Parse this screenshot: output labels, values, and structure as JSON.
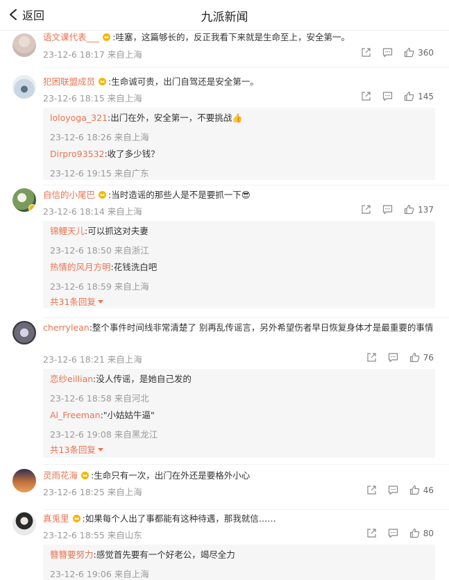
{
  "header": {
    "back_label": "返回",
    "title": "九派新闻"
  },
  "comments": [
    {
      "user": "语文课代表___",
      "text": ":哇塞，这篇够长的，反正我看下来就是生命至上，安全第一。",
      "time": "23-12-6 18:17 来自上海",
      "likes": "360",
      "more_replies": "",
      "replies": []
    },
    {
      "user": "犯困联盟成员",
      "text": ":生命诚可贵，出门自驾还是安全第一。",
      "time": "23-12-6 18:15 来自上海",
      "likes": "145",
      "more_replies": "",
      "replies": [
        {
          "user": "loloyoga_321",
          "text": ":出门在外，安全第一，不要挑战👍",
          "time": "23-12-6 18:26 来自上海"
        },
        {
          "user": "Dirpro93532",
          "text": ":收了多少钱？",
          "time": "23-12-6 19:15 来自广东"
        }
      ]
    },
    {
      "user": "自信的小尾巴",
      "text": ":当时造谣的那些人是不是要抓一下😎",
      "time": "23-12-6 18:14 来自上海",
      "likes": "137",
      "more_replies": "共31条回复",
      "replies": [
        {
          "user": "锦鲤天儿",
          "text": ":可以抓这对夫妻",
          "time": "23-12-6 18:50 来自浙江"
        },
        {
          "user": "热情的风月方明",
          "text": ":花钱洗白吧",
          "time": "23-12-6 18:59 来自上海"
        }
      ]
    },
    {
      "user": "cherrylean",
      "text": ":整个事件时间线非常清楚了 别再乱传谣言，另外希望伤者早日恢复身体才是最重要的事情",
      "time": "23-12-6 18:21 来自上海",
      "likes": "76",
      "more_replies": "共13条回复",
      "replies": [
        {
          "user": "恋纱eillian",
          "text": ":没人传谣，是她自己发的",
          "time": "23-12-6 18:58 来自河北"
        },
        {
          "user": "Al_Freeman",
          "text": ":\"小姑姑牛逼\"",
          "time": "23-12-6 19:08 来自黑龙江"
        }
      ]
    },
    {
      "user": "灵雨花海",
      "text": ":生命只有一次，出门在外还是要格外小心",
      "time": "23-12-6 18:25 来自上海",
      "likes": "46",
      "more_replies": "",
      "replies": []
    },
    {
      "user": "真兎里",
      "text": ":如果每个人出了事都能有这种待遇，那我就信……",
      "time": "23-12-6 18:55 来自山东",
      "likes": "80",
      "more_replies": "",
      "replies": [
        {
          "user": "簪簪要努力",
          "text": ":感觉首先要有一个好老公，竭尽全力",
          "time": "23-12-6 19:06 来自上海"
        }
      ]
    }
  ],
  "icons": {
    "back": "chevron-left-icon",
    "share": "share-icon",
    "comment": "comment-icon",
    "like": "thumbs-up-icon",
    "badge": "vip-crown-icon"
  },
  "colors": {
    "username": "#eb7350",
    "meta": "#999999",
    "reply_bg": "#f6f6f6",
    "crown": "#f7b500"
  }
}
